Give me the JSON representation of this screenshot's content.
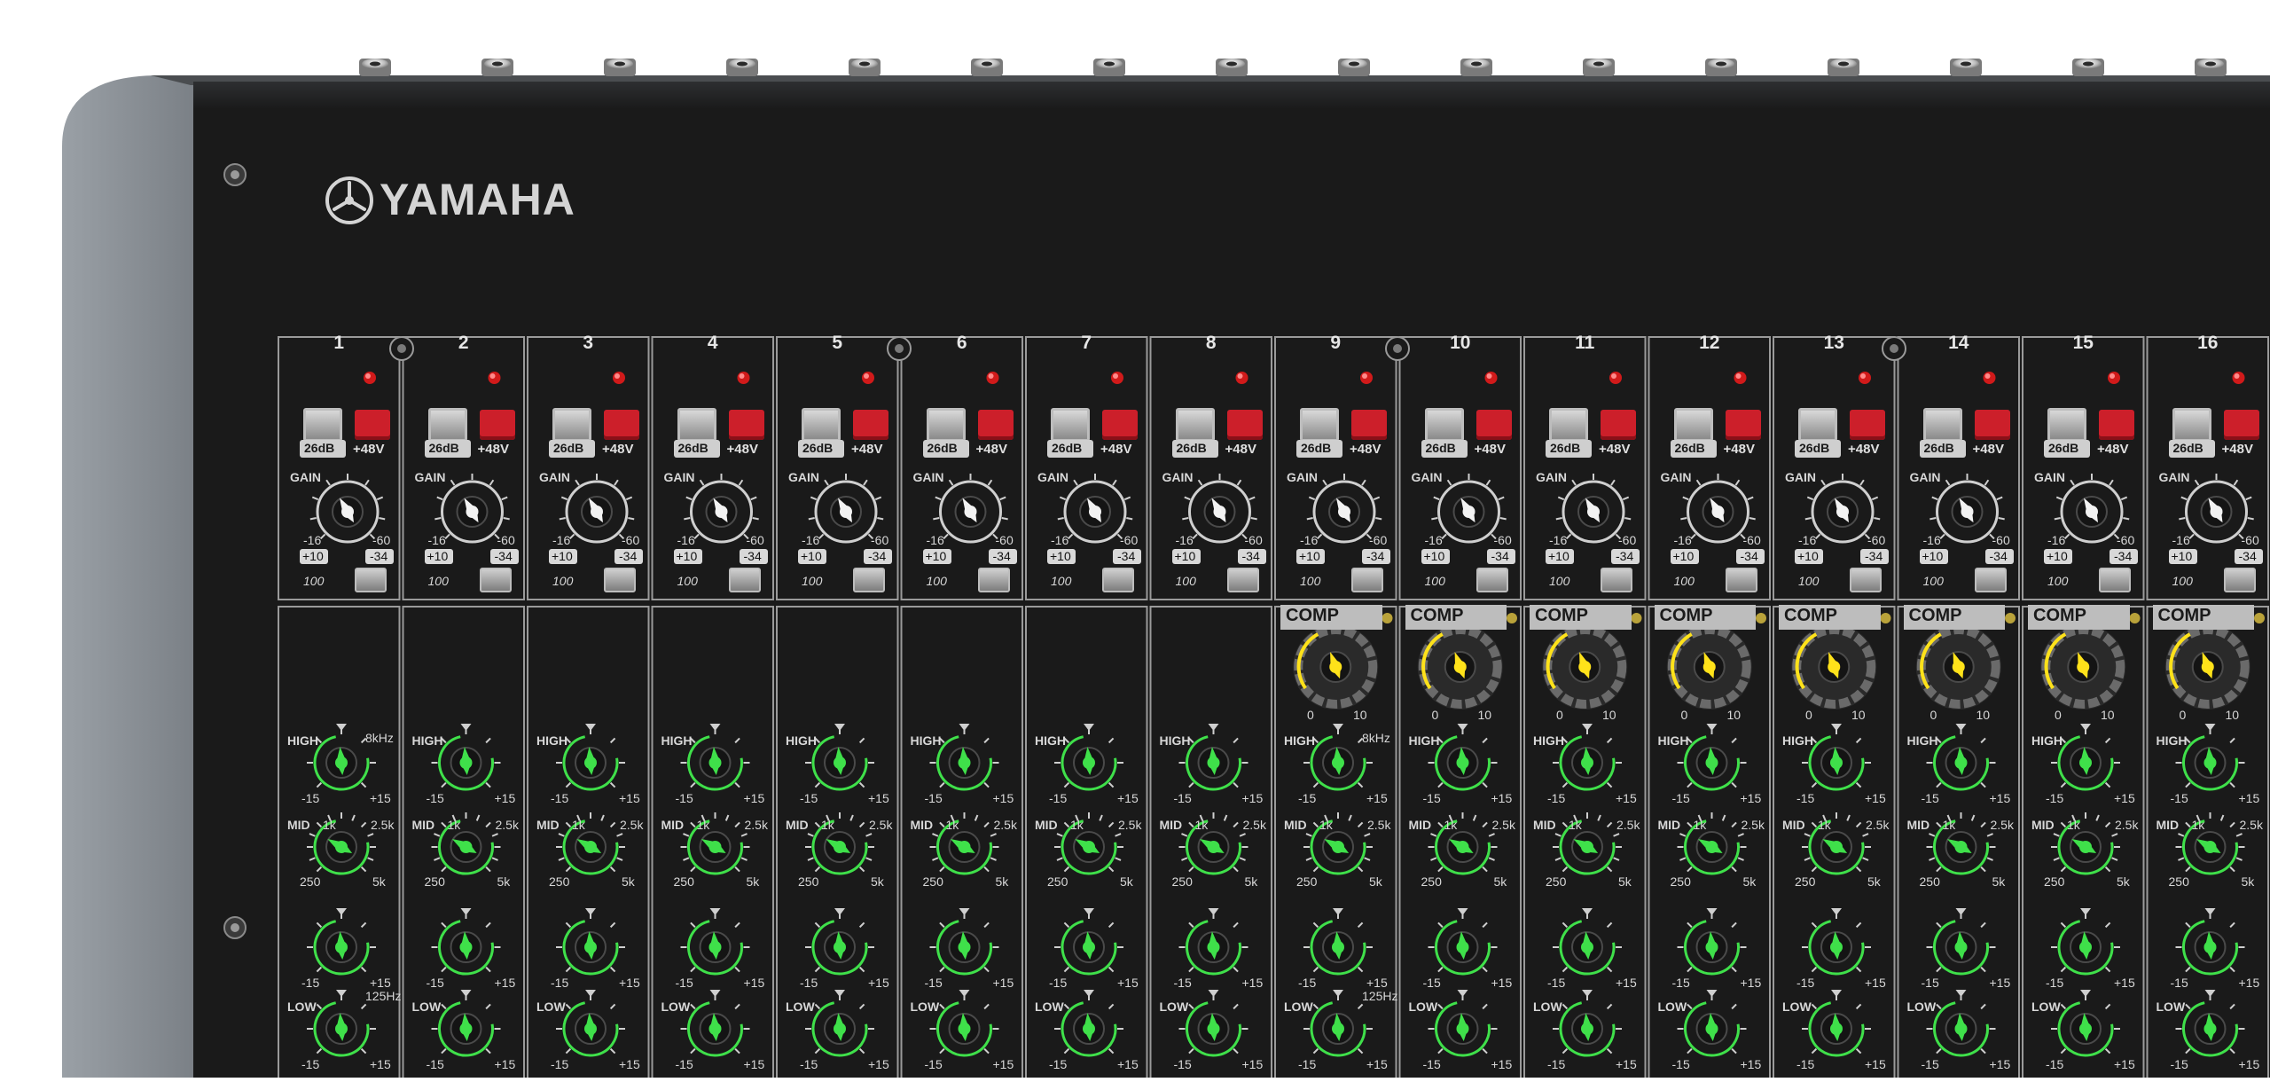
{
  "brand": {
    "name": "YAMAHA",
    "color": "#d4d4d4",
    "emblem": "tuning-fork-emblem"
  },
  "colors": {
    "panel": "#1a1a1a",
    "chassis": "#2b2b2b",
    "phantom_button": "#cc1f2a",
    "led": "#d11a1a",
    "eq_knob": "#3fe04a",
    "comp_knob": "#ffe21a",
    "gain_knob": "#f2f2f2",
    "strip_line": "#9a9a9a"
  },
  "channels": [
    {
      "number": "1",
      "comp": false,
      "freq_high": "8kHz",
      "freq_low": "125Hz"
    },
    {
      "number": "2",
      "comp": false,
      "freq_high": "",
      "freq_low": ""
    },
    {
      "number": "3",
      "comp": false,
      "freq_high": "",
      "freq_low": ""
    },
    {
      "number": "4",
      "comp": false,
      "freq_high": "",
      "freq_low": ""
    },
    {
      "number": "5",
      "comp": false,
      "freq_high": "",
      "freq_low": ""
    },
    {
      "number": "6",
      "comp": false,
      "freq_high": "",
      "freq_low": ""
    },
    {
      "number": "7",
      "comp": false,
      "freq_high": "",
      "freq_low": ""
    },
    {
      "number": "8",
      "comp": false,
      "freq_high": "",
      "freq_low": ""
    },
    {
      "number": "9",
      "comp": true,
      "freq_high": "8kHz",
      "freq_low": "125Hz"
    },
    {
      "number": "10",
      "comp": true,
      "freq_high": "",
      "freq_low": ""
    },
    {
      "number": "11",
      "comp": true,
      "freq_high": "",
      "freq_low": ""
    },
    {
      "number": "12",
      "comp": true,
      "freq_high": "",
      "freq_low": ""
    },
    {
      "number": "13",
      "comp": true,
      "freq_high": "",
      "freq_low": ""
    },
    {
      "number": "14",
      "comp": true,
      "freq_high": "",
      "freq_low": ""
    },
    {
      "number": "15",
      "comp": true,
      "freq_high": "",
      "freq_low": ""
    },
    {
      "number": "16",
      "comp": true,
      "freq_high": "",
      "freq_low": ""
    }
  ],
  "labels": {
    "pad": "26dB",
    "phantom": "+48V",
    "gain": "GAIN",
    "gain_min_mic": "-16",
    "gain_max_mic": "-60",
    "gain_min_line": "+10",
    "gain_max_line": "-34",
    "hpf": "100",
    "comp": "COMP",
    "comp_min": "0",
    "comp_max": "10",
    "high": "HIGH",
    "mid": "MID",
    "low": "LOW",
    "mid_f1": "1k",
    "mid_f2": "2.5k",
    "mid_f3": "250",
    "mid_f4": "5k",
    "eq_min": "-15",
    "eq_max": "+15"
  }
}
